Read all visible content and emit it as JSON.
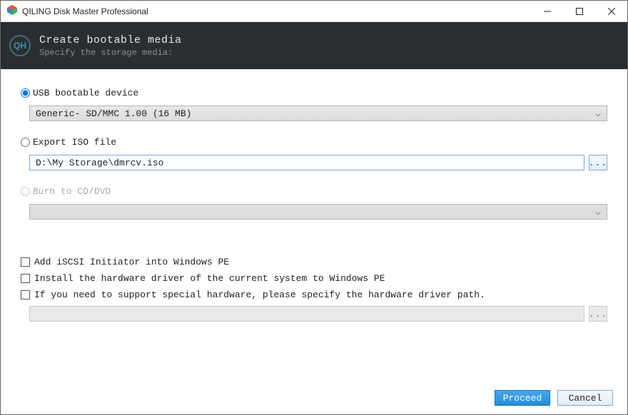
{
  "window": {
    "title": "QILING Disk Master Professional"
  },
  "header": {
    "title": "Create bootable media",
    "subtitle": "Specify the storage media:",
    "icon": "QH"
  },
  "options": {
    "usb": {
      "label": "USB bootable device",
      "selected": true,
      "value": "Generic- SD/MMC 1.00 (16 MB)"
    },
    "iso": {
      "label": "Export ISO file",
      "selected": false,
      "path": "D:\\My Storage\\dmrcv.iso"
    },
    "cd": {
      "label": "Burn to CD/DVD",
      "selected": false,
      "disabled": true,
      "value": ""
    }
  },
  "checks": {
    "iscsi": "Add iSCSI Initiator into Windows PE",
    "driver": "Install the hardware driver of the current system to Windows PE",
    "special": "If you need to support special hardware, please specify the hardware driver path.",
    "special_path": ""
  },
  "buttons": {
    "proceed": "Proceed",
    "cancel": "Cancel",
    "browse": "..."
  }
}
